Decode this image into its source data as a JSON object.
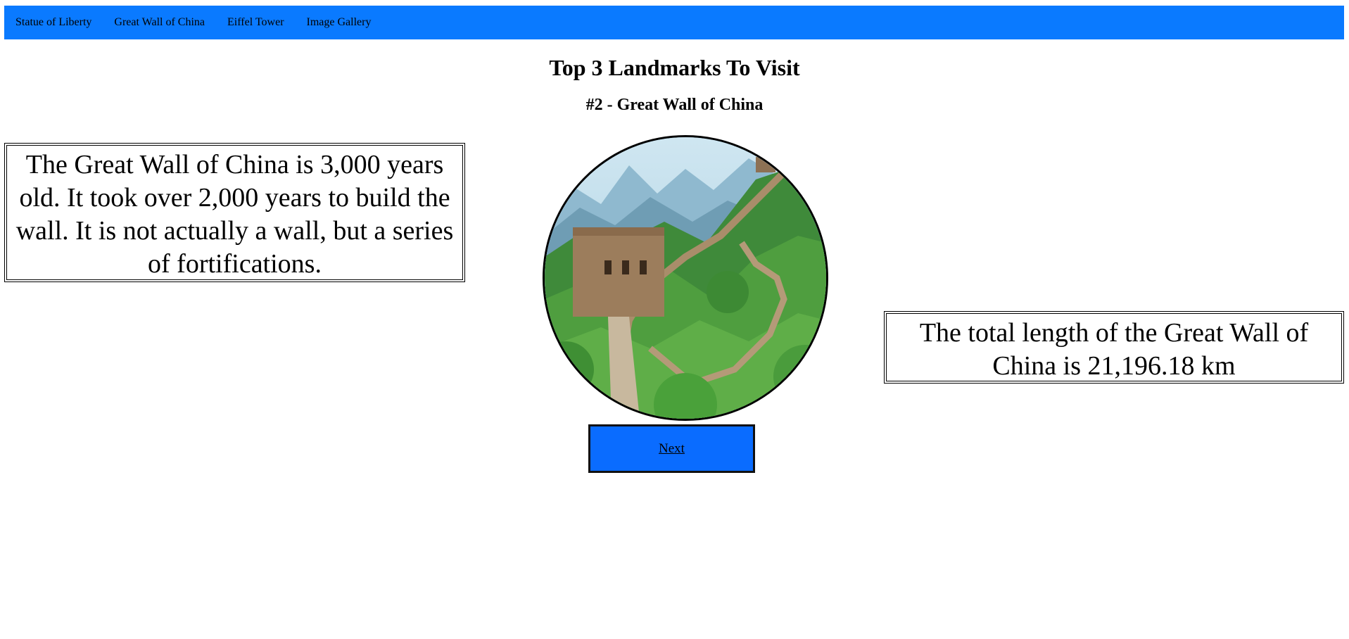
{
  "nav": {
    "items": [
      {
        "label": "Statue of Liberty"
      },
      {
        "label": "Great Wall of China"
      },
      {
        "label": "Eiffel Tower"
      },
      {
        "label": "Image Gallery"
      }
    ]
  },
  "main": {
    "title": "Top 3 Landmarks To Visit",
    "subtitle": "#2 - Great Wall of China",
    "fact_left": "The Great Wall of China is 3,000 years old. It took over 2,000 years to build the wall. It is not actually a wall, but a series of fortifications.",
    "fact_right": "The total length of the Great Wall of China is 21,196.18 km",
    "next_label": "Next"
  },
  "colors": {
    "navbar": "#0a7aff",
    "button": "#0a6cff"
  }
}
